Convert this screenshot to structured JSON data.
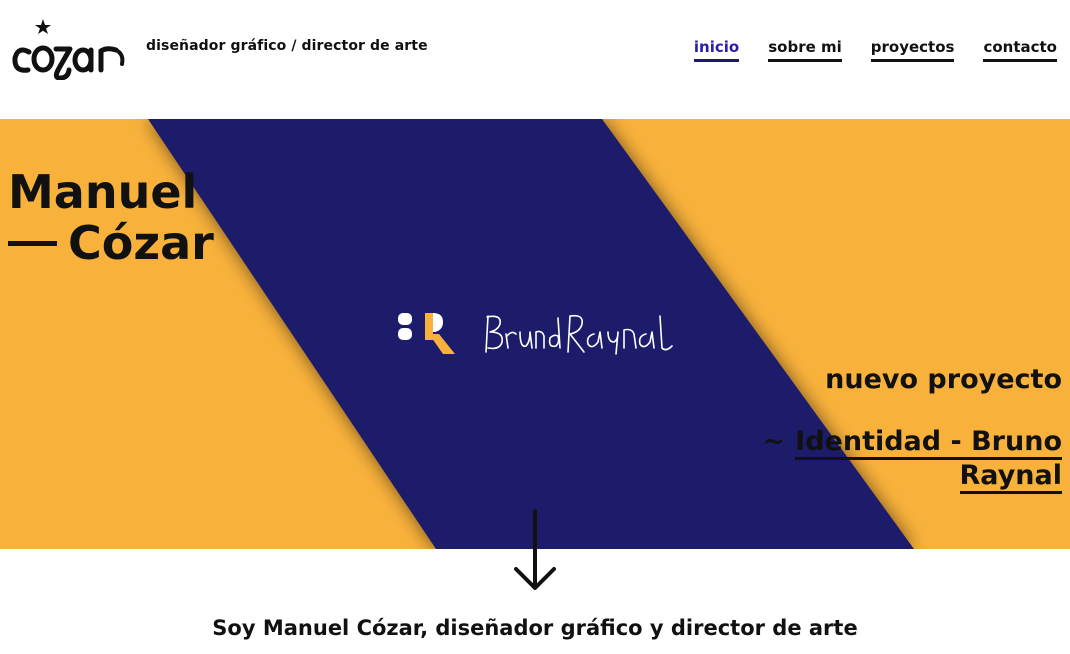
{
  "header": {
    "logo_text": "cozar",
    "tagline": "diseñador gráfico / director de arte"
  },
  "nav": {
    "items": [
      {
        "label": "inicio",
        "active": true
      },
      {
        "label": "sobre mi",
        "active": false
      },
      {
        "label": "proyectos",
        "active": false
      },
      {
        "label": "contacto",
        "active": false
      }
    ]
  },
  "hero": {
    "title_line1": "Manuel",
    "title_line2": "Cózar",
    "featured_brand": "Bruno Raynal",
    "news_label": "nuevo proyecto",
    "news_prefix": "~",
    "news_link": "Identidad - Bruno Raynal"
  },
  "intro": {
    "text": "Soy Manuel Cózar, diseñador gráfico y director de arte"
  },
  "colors": {
    "accent_yellow": "#f8b13b",
    "band_navy": "#1c1a6b",
    "active_nav": "#2b1fa3",
    "text": "#111111"
  },
  "icons": {
    "logo_star": "star-icon",
    "scroll": "arrow-down-icon"
  }
}
